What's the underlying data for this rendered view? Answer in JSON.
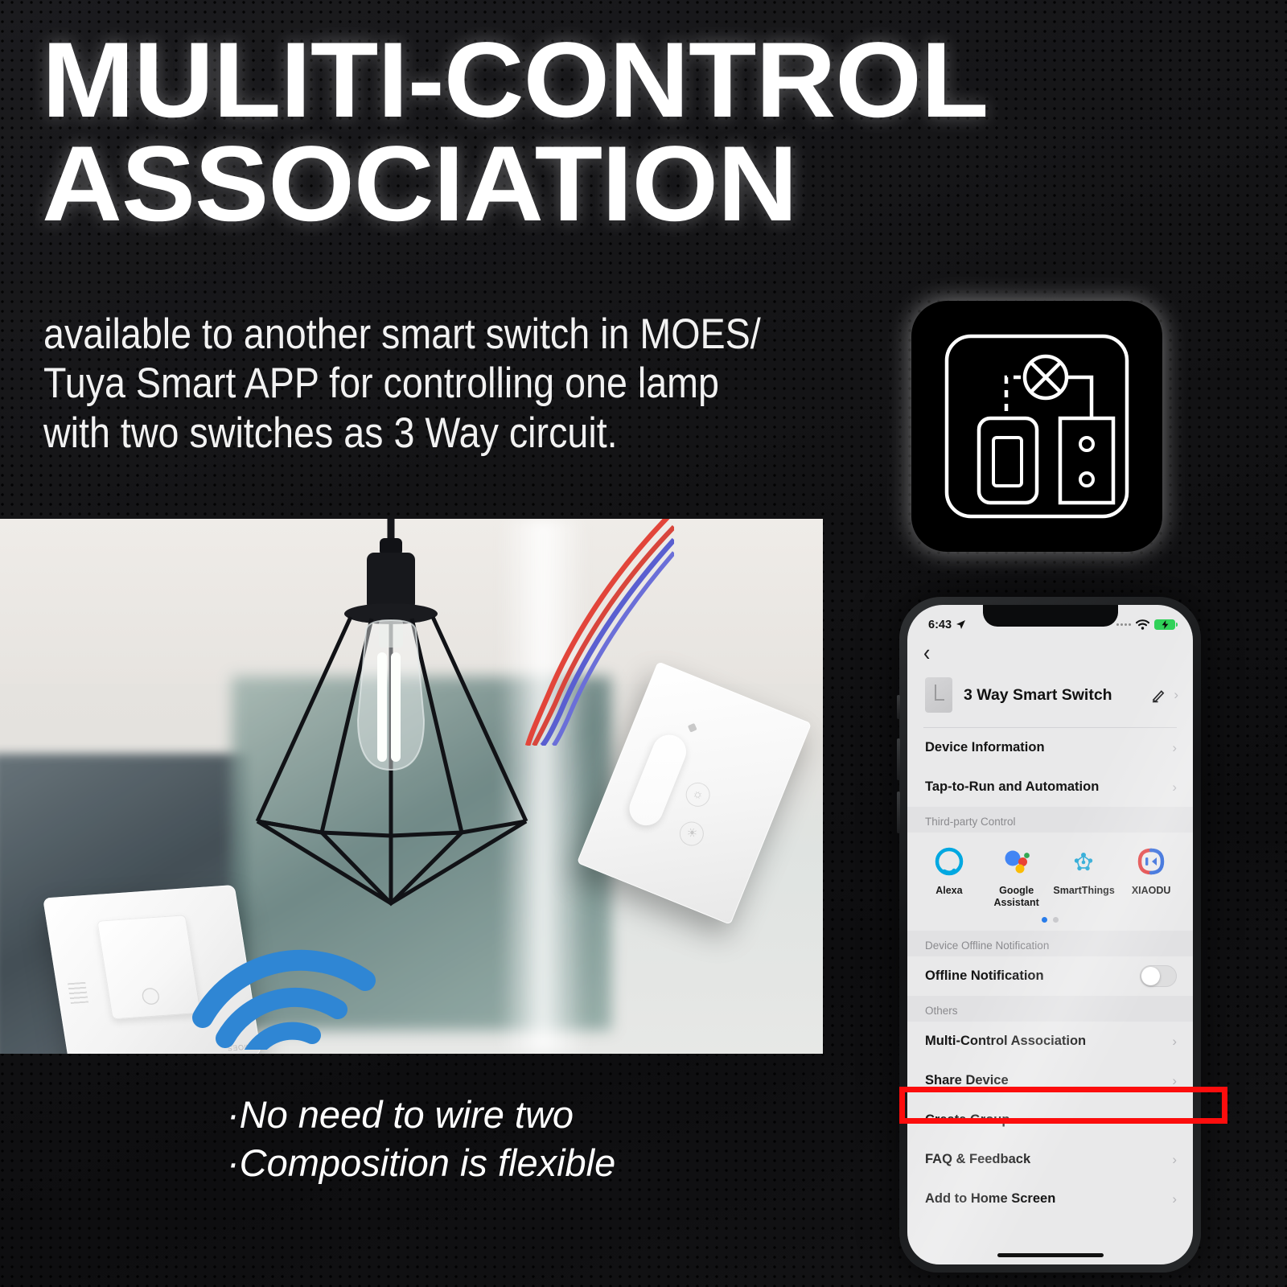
{
  "headline": {
    "line1": "MULITI-CONTROL",
    "line2": "ASSOCIATION"
  },
  "subhead": {
    "line1": "available to another smart switch in MOES/",
    "line2": "Tuya Smart APP for controlling one lamp",
    "line3": "with two switches as 3 Way circuit."
  },
  "bullets": {
    "line1": "·No need to wire two",
    "line2": "·Composition is flexible"
  },
  "badge": {
    "icon_name": "two-switches-one-lamp-icon"
  },
  "photo": {
    "left_switch_brand": "MOES"
  },
  "phone": {
    "statusbar": {
      "time": "6:43",
      "location_icon": "➤",
      "signal_icon": "signal-dots",
      "wifi_icon": "wifi-icon",
      "battery_icon": "battery-charging-icon"
    },
    "nav": {
      "back_label": "‹"
    },
    "device": {
      "title": "3 Way Smart Switch",
      "edit_icon": "pencil-icon",
      "chevron": "›"
    },
    "rows_top": [
      {
        "label": "Device Information",
        "chevron": "›"
      },
      {
        "label": "Tap-to-Run and Automation",
        "chevron": "›"
      }
    ],
    "third_party": {
      "heading": "Third-party Control",
      "items": [
        {
          "label": "Alexa",
          "icon": "alexa-icon",
          "color": "#00a8e1"
        },
        {
          "label": "Google\nAssistant",
          "icon": "google-assistant-icon",
          "color": "#4285f4"
        },
        {
          "label": "SmartThings",
          "icon": "smartthings-icon",
          "color": "#15bfff"
        },
        {
          "label": "XIAODU",
          "icon": "xiaodu-icon",
          "color": "#2661d8"
        }
      ],
      "page_dots": 2,
      "active_dot": 0
    },
    "offline_section": {
      "heading": "Device Offline Notification",
      "row_label": "Offline Notification",
      "toggle_on": false
    },
    "others_section": {
      "heading": "Others",
      "rows": [
        {
          "label": "Multi-Control Association",
          "chevron": "›",
          "highlighted": false
        },
        {
          "label": "Share Device",
          "chevron": "›",
          "highlighted": true
        },
        {
          "label": "Create Group",
          "chevron": "›",
          "highlighted": false
        },
        {
          "label": "FAQ & Feedback",
          "chevron": "›",
          "highlighted": false
        },
        {
          "label": "Add to Home Screen",
          "chevron": "›",
          "highlighted": false
        }
      ]
    },
    "highlight_color": "#fc0d0d"
  }
}
